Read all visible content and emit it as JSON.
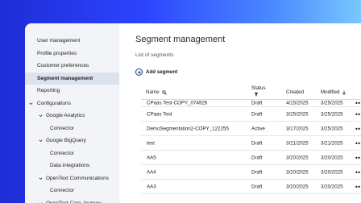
{
  "sidebar": {
    "items": [
      {
        "label": "User management",
        "indent": 0,
        "chevron": "",
        "selected": false
      },
      {
        "label": "Profile properties",
        "indent": 0,
        "chevron": "",
        "selected": false
      },
      {
        "label": "Customer preferences",
        "indent": 0,
        "chevron": "",
        "selected": false
      },
      {
        "label": "Segment management",
        "indent": 0,
        "chevron": "",
        "selected": true
      },
      {
        "label": "Reporting",
        "indent": 0,
        "chevron": "",
        "selected": false
      },
      {
        "label": "Configurations",
        "indent": 0,
        "chevron": "chevron-down",
        "selected": false
      },
      {
        "label": "Google Analytics",
        "indent": 1,
        "chevron": "chevron-down",
        "selected": false
      },
      {
        "label": "Connector",
        "indent": 2,
        "chevron": "",
        "selected": false
      },
      {
        "label": "Google BigQuery",
        "indent": 1,
        "chevron": "chevron-down",
        "selected": false
      },
      {
        "label": "Connector",
        "indent": 2,
        "chevron": "",
        "selected": false
      },
      {
        "label": "Data integrations",
        "indent": 2,
        "chevron": "",
        "selected": false
      },
      {
        "label": "OpenText Communications",
        "indent": 1,
        "chevron": "chevron-down",
        "selected": false
      },
      {
        "label": "Connector",
        "indent": 2,
        "chevron": "",
        "selected": false
      },
      {
        "label": "OpenText Core Journey",
        "indent": 1,
        "chevron": "chevron-down",
        "selected": false
      }
    ]
  },
  "main": {
    "title": "Segment management",
    "subtitle": "List of segments",
    "add_label": "Add segment"
  },
  "table": {
    "headers": {
      "name": "Name",
      "status": "Status",
      "created": "Created",
      "modified": "Modified"
    },
    "rows": [
      {
        "name": "CPaas Test-COPY_074926",
        "status": "Draft",
        "created": "4/15/2025",
        "modified": "3/25/2025"
      },
      {
        "name": "CPaas Test",
        "status": "Draft",
        "created": "3/25/2025",
        "modified": "3/25/2025"
      },
      {
        "name": "DemoSegmentation2-COPY_122255",
        "status": "Active",
        "created": "3/17/2025",
        "modified": "3/25/2025"
      },
      {
        "name": "test",
        "status": "Draft",
        "created": "3/21/2025",
        "modified": "3/21/2025"
      },
      {
        "name": "AA5",
        "status": "Draft",
        "created": "3/20/2025",
        "modified": "3/20/2025"
      },
      {
        "name": "AA4",
        "status": "Draft",
        "created": "3/20/2025",
        "modified": "3/20/2025"
      },
      {
        "name": "AA3",
        "status": "Draft",
        "created": "3/20/2025",
        "modified": "3/20/2025"
      }
    ],
    "more_label": "•••"
  },
  "colors": {
    "accent": "#1f3a8a",
    "sidebar_bg": "#f2f4f7",
    "selected_bg": "#dde3ec"
  }
}
